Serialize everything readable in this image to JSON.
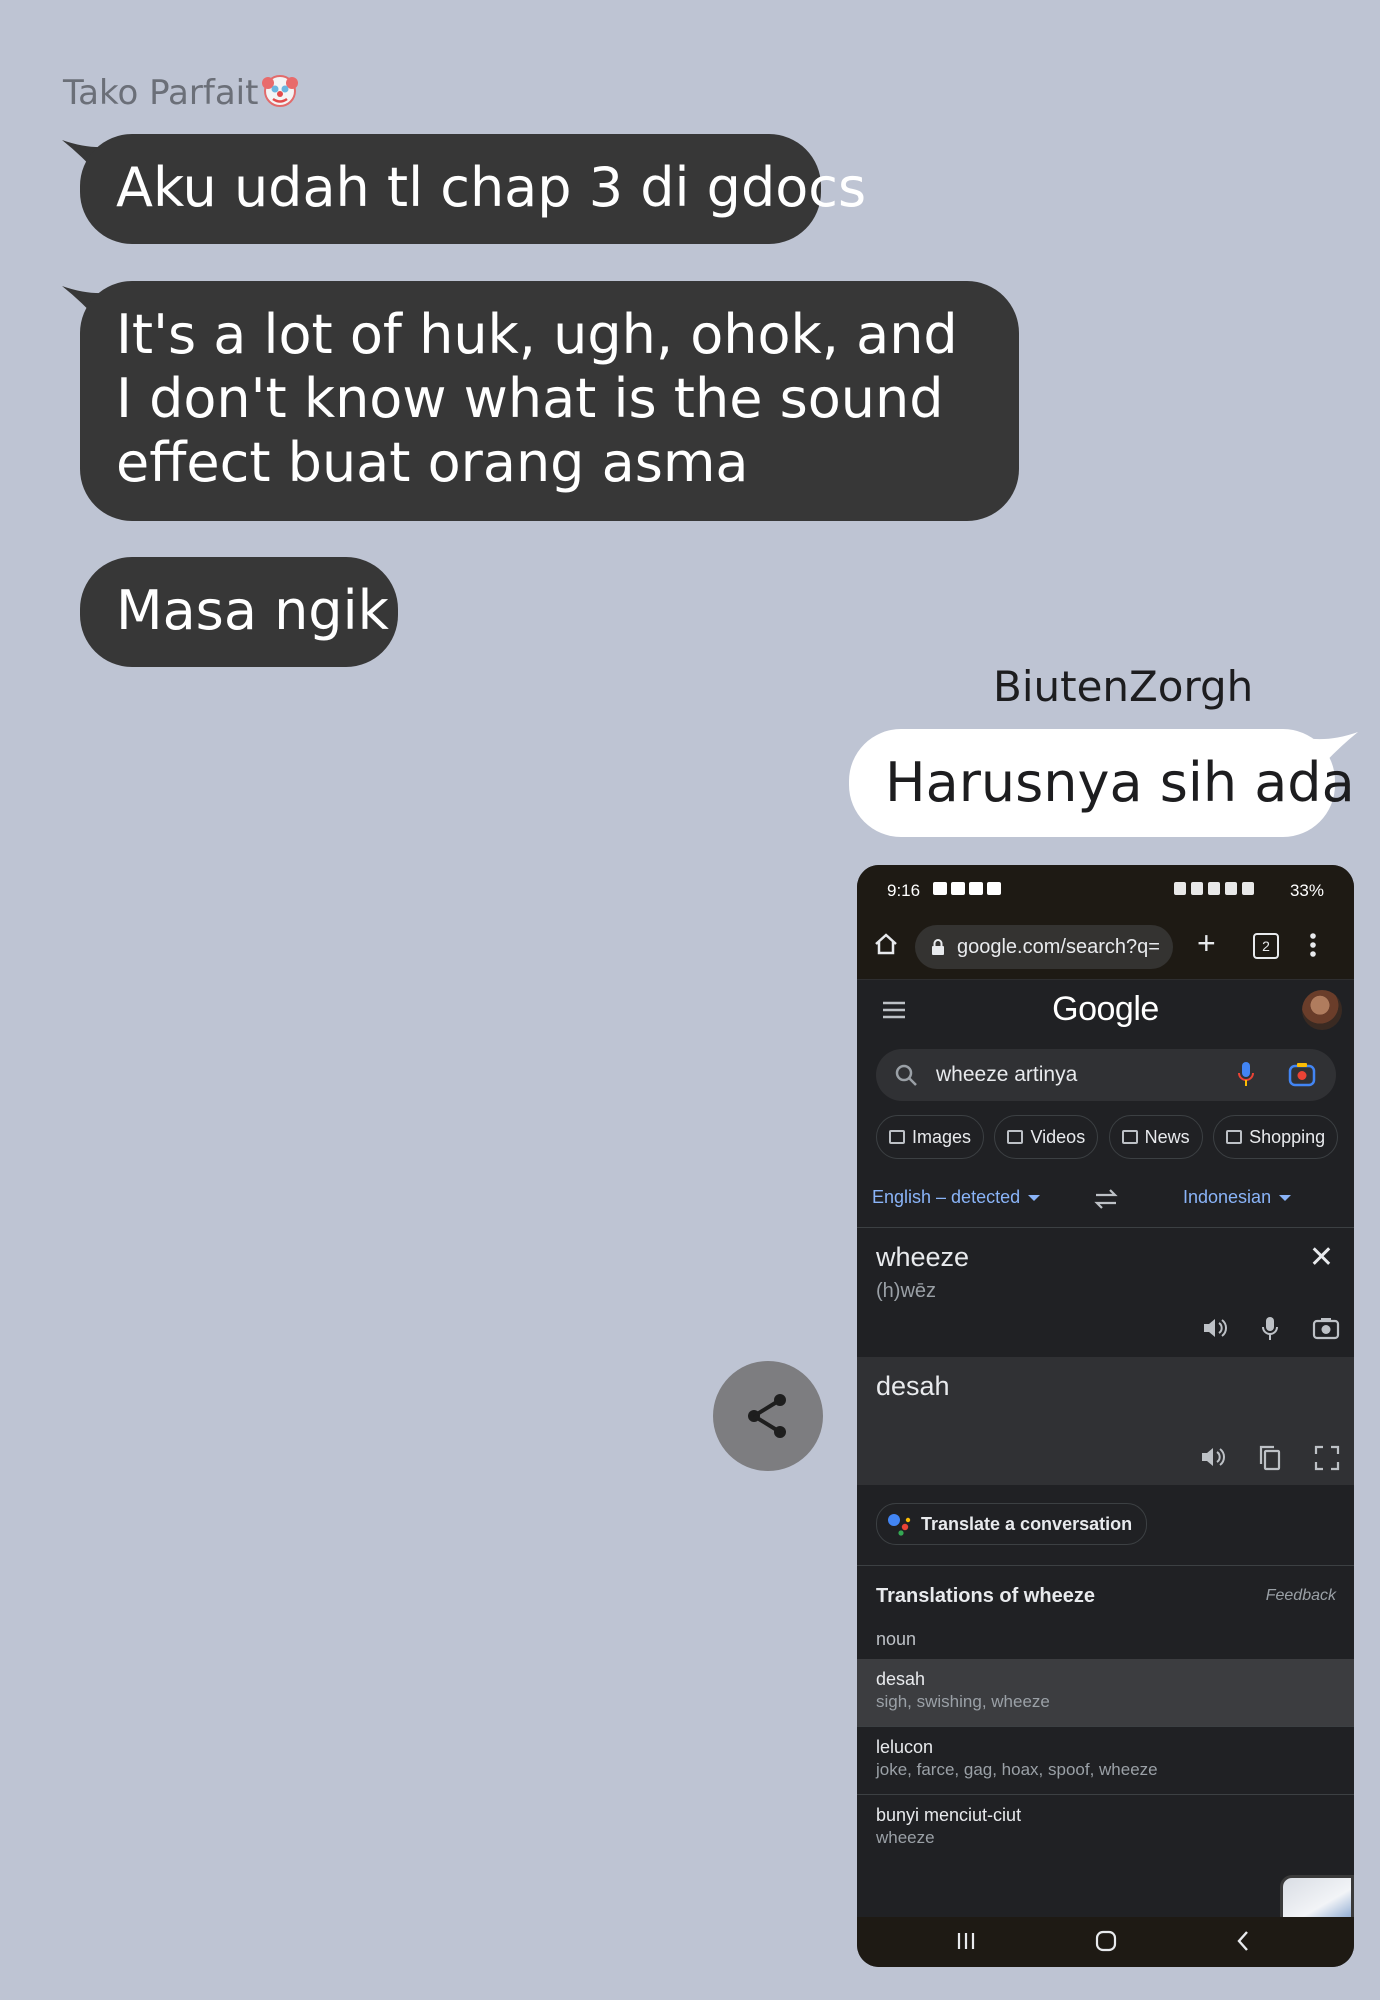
{
  "chat": {
    "other_sender": "Tako Parfait",
    "other_sender_emoji": "clown",
    "messages_left": [
      "Aku udah tl chap 3 di gdocs",
      "It's a lot of huk, ugh, ohok, and",
      "I don't know what is the sound",
      "effect buat orang asma",
      "Masa ngik"
    ],
    "me_sender": "BiutenZorgh",
    "messages_right": [
      "Harusnya sih ada"
    ],
    "share_icon": "share-icon"
  },
  "phone": {
    "status": {
      "time": "9:16",
      "battery": "33%"
    },
    "browser": {
      "url": "google.com/search?q=",
      "tab_count": "2"
    },
    "google": {
      "logo": "Google",
      "query": "wheeze artinya",
      "chips": [
        "Images",
        "Videos",
        "News",
        "Shopping"
      ]
    },
    "translate": {
      "source_lang": "English – detected",
      "target_lang": "Indonesian",
      "source_word": "wheeze",
      "phonetic": "(h)wēz",
      "target_word": "desah",
      "conversation_button": "Translate a conversation",
      "translations_title": "Translations of wheeze",
      "feedback": "Feedback",
      "part_of_speech": "noun",
      "rows": [
        {
          "word": "desah",
          "synonyms": "sigh, swishing, wheeze"
        },
        {
          "word": "lelucon",
          "synonyms": "joke, farce, gag, hoax, spoof, wheeze"
        },
        {
          "word": "bunyi menciut-ciut",
          "synonyms": "wheeze"
        }
      ]
    },
    "colors": {
      "link": "#8ab4f8",
      "dark_bg": "#202124",
      "panel": "#303134"
    }
  }
}
